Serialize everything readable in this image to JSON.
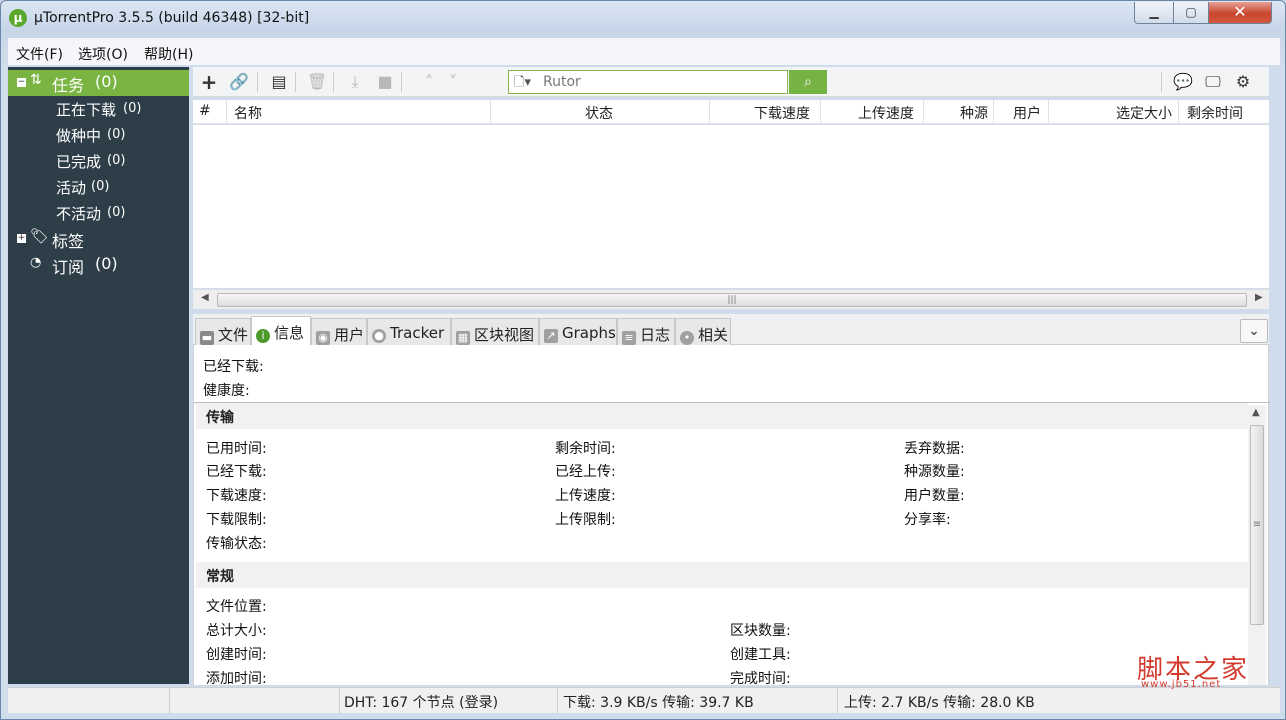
{
  "window": {
    "title": "µTorrentPro 3.5.5  (build 46348) [32-bit]",
    "logo_text": "µ",
    "min_glyph": "▁",
    "max_glyph": "▢",
    "close_glyph": "✕"
  },
  "menu": [
    "文件(F)",
    "选项(O)",
    "帮助(H)"
  ],
  "sidebar": {
    "tasks": {
      "label": "任务",
      "count": "(0)"
    },
    "items": [
      {
        "label": "正在下载",
        "count": "(0)"
      },
      {
        "label": "做种中",
        "count": "(0)"
      },
      {
        "label": "已完成",
        "count": "(0)"
      },
      {
        "label": "活动",
        "count": "(0)"
      },
      {
        "label": "不活动",
        "count": "(0)"
      }
    ],
    "labels": {
      "label": "标签"
    },
    "feeds": {
      "label": "订阅",
      "count": "(0)"
    }
  },
  "toolbar": {
    "search_placeholder": "Rutor",
    "icons": [
      "add-torrent-icon",
      "add-url-icon",
      "create-torrent-icon",
      "remove-icon",
      "start-icon",
      "stop-icon",
      "move-up-icon",
      "move-down-icon",
      "chat-icon",
      "remote-icon",
      "settings-icon"
    ]
  },
  "columns": [
    "#",
    "名称",
    "状态",
    "下载速度",
    "上传速度",
    "种源",
    "用户",
    "选定大小",
    "剩余时间"
  ],
  "tabs": [
    {
      "label": "文件",
      "icon": "folder-icon"
    },
    {
      "label": "信息",
      "icon": "info-icon"
    },
    {
      "label": "用户",
      "icon": "peers-icon"
    },
    {
      "label": "Tracker",
      "icon": "tracker-icon"
    },
    {
      "label": "区块视图",
      "icon": "pieces-icon"
    },
    {
      "label": "Graphs",
      "icon": "graphs-icon"
    },
    {
      "label": "日志",
      "icon": "log-icon"
    },
    {
      "label": "相关",
      "icon": "related-icon"
    }
  ],
  "info": {
    "downloaded": "已经下载:",
    "health": "健康度:",
    "transfer_title": "传输",
    "transfer": [
      [
        "已用时间:",
        "剩余时间:",
        "丢弃数据:"
      ],
      [
        "已经下载:",
        "已经上传:",
        "种源数量:"
      ],
      [
        "下载速度:",
        "上传速度:",
        "用户数量:"
      ],
      [
        "下载限制:",
        "上传限制:",
        "分享率:"
      ],
      [
        "传输状态:",
        "",
        ""
      ]
    ],
    "general_title": "常规",
    "general": [
      [
        "文件位置:",
        ""
      ],
      [
        "总计大小:",
        "区块数量:"
      ],
      [
        "创建时间:",
        "创建工具:"
      ],
      [
        "添加时间:",
        "完成时间:"
      ]
    ]
  },
  "status": {
    "dht": "DHT: 167 个节点  (登录)",
    "download": "下载: 3.9 KB/s 传输: 39.7 KB",
    "upload": "上传: 2.7 KB/s 传输: 28.0 KB"
  },
  "watermark": {
    "text": "脚本之家",
    "url": "www.jb51.net"
  }
}
